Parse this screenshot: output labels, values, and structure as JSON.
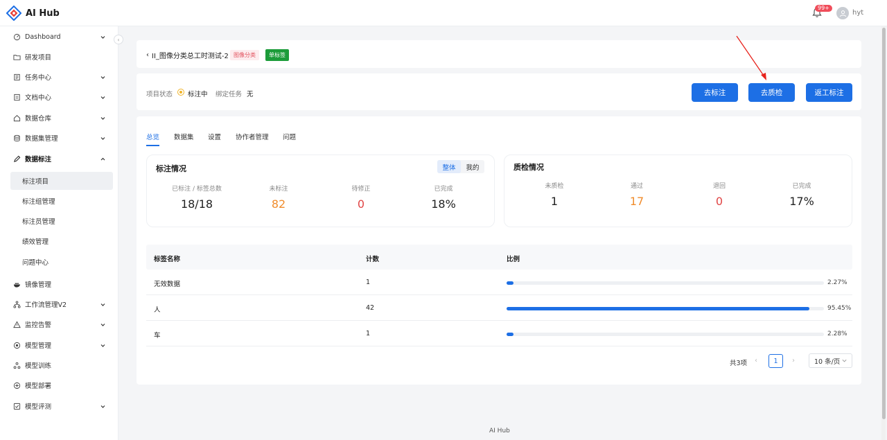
{
  "app": {
    "title": "AI Hub",
    "notifications_badge": "99+",
    "username": "hyt"
  },
  "sidebar": {
    "items": [
      {
        "label": "Dashboard",
        "icon": "dashboard-icon",
        "expandable": true
      },
      {
        "label": "研发项目",
        "icon": "folder-icon",
        "expandable": false
      },
      {
        "label": "任务中心",
        "icon": "task-icon",
        "expandable": true
      },
      {
        "label": "文档中心",
        "icon": "doc-icon",
        "expandable": true
      },
      {
        "label": "数据仓库",
        "icon": "home-icon",
        "expandable": true
      },
      {
        "label": "数据集管理",
        "icon": "database-icon",
        "expandable": true
      },
      {
        "label": "数据标注",
        "icon": "annotate-icon",
        "expandable": true,
        "open": true
      },
      {
        "label": "标注项目",
        "sub": true,
        "active": true
      },
      {
        "label": "标注组管理",
        "sub": true
      },
      {
        "label": "标注员管理",
        "sub": true
      },
      {
        "label": "绩效管理",
        "sub": true
      },
      {
        "label": "问题中心",
        "sub": true
      },
      {
        "label": "镜像管理",
        "icon": "docker-icon",
        "expandable": false
      },
      {
        "label": "工作流管理V2",
        "icon": "workflow-icon",
        "expandable": true
      },
      {
        "label": "监控告警",
        "icon": "alert-icon",
        "expandable": true
      },
      {
        "label": "模型管理",
        "icon": "model-icon",
        "expandable": true
      },
      {
        "label": "模型训练",
        "icon": "train-icon",
        "expandable": false
      },
      {
        "label": "模型部署",
        "icon": "deploy-icon",
        "expandable": false
      },
      {
        "label": "模型评测",
        "icon": "eval-icon",
        "expandable": true
      }
    ]
  },
  "project": {
    "name": "II_图像分类总工时测试-2",
    "tag_type": "图像分类",
    "tag_label": "单标签",
    "status_label": "项目状态",
    "status_value": "标注中",
    "bind_label": "绑定任务",
    "bind_value": "无"
  },
  "actions": {
    "annotate": "去标注",
    "inspect": "去质检",
    "rework": "返工标注"
  },
  "tabs": [
    "总览",
    "数据集",
    "设置",
    "协作者管理",
    "问题"
  ],
  "annotation": {
    "title": "标注情况",
    "toggle": [
      "整体",
      "我的"
    ],
    "stats": [
      {
        "label": "已标注 / 标签总数",
        "value": "18/18"
      },
      {
        "label": "未标注",
        "value": "82"
      },
      {
        "label": "待修正",
        "value": "0"
      },
      {
        "label": "已完成",
        "value": "18%"
      }
    ]
  },
  "inspection": {
    "title": "质检情况",
    "stats": [
      {
        "label": "未质检",
        "value": "1"
      },
      {
        "label": "通过",
        "value": "17"
      },
      {
        "label": "退回",
        "value": "0"
      },
      {
        "label": "已完成",
        "value": "17%"
      }
    ]
  },
  "table": {
    "headers": [
      "标签名称",
      "计数",
      "比例"
    ],
    "rows": [
      {
        "name": "无效数据",
        "count": "1",
        "ratio": 2.27,
        "ratio_text": "2.27%"
      },
      {
        "name": "人",
        "count": "42",
        "ratio": 95.45,
        "ratio_text": "95.45%"
      },
      {
        "name": "车",
        "count": "1",
        "ratio": 2.28,
        "ratio_text": "2.28%"
      }
    ]
  },
  "pagination": {
    "total": "共3项",
    "current": "1",
    "page_size": "10 条/页"
  },
  "footer": "AI Hub",
  "colors": {
    "primary": "#1d6fe5",
    "orange": "#f08c2c",
    "red": "#e04545",
    "green_tag": "#1c9c3a"
  }
}
